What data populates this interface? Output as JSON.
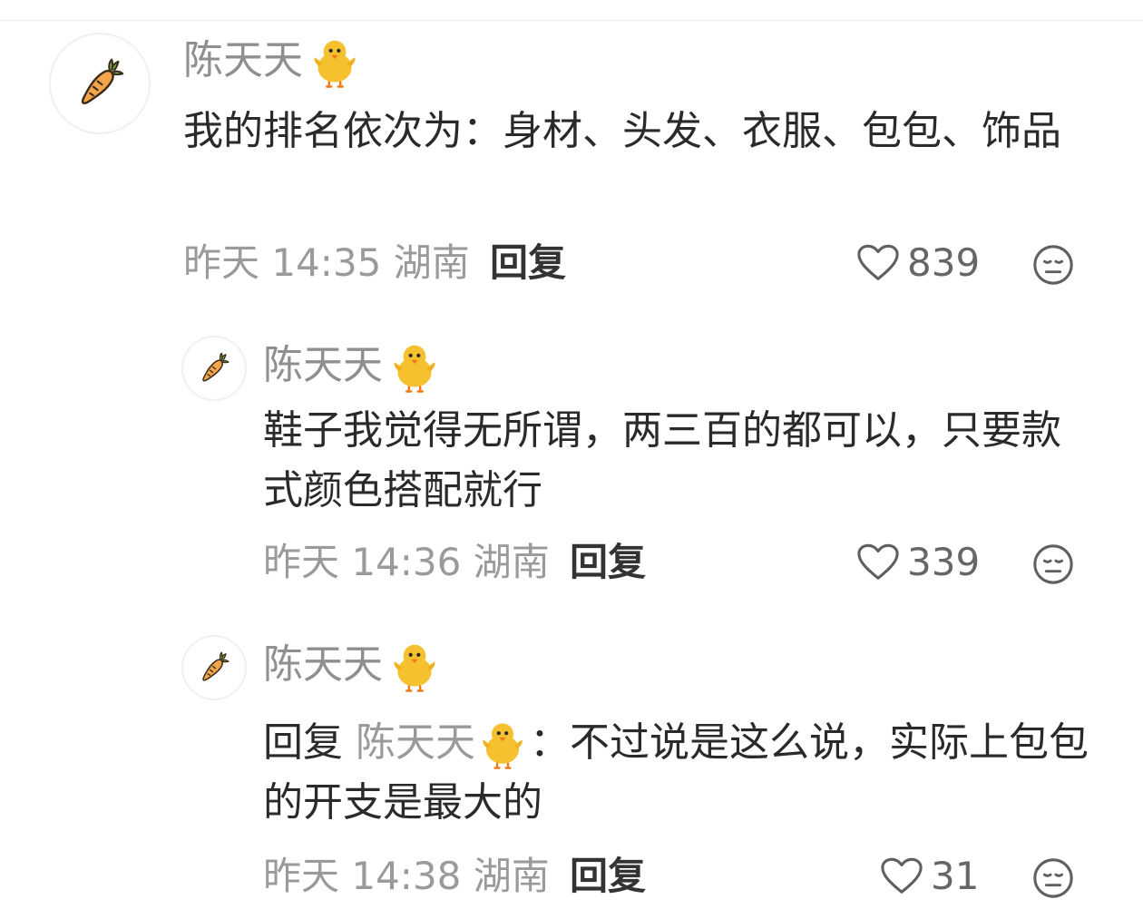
{
  "comments": [
    {
      "username": "陈天天",
      "text": "我的排名依次为：身材、头发、衣服、包包、饰品",
      "time": "昨天 14:35",
      "location": "湖南",
      "reply_label": "回复",
      "likes": "839",
      "avatar_icon": "carrot-icon",
      "username_icon": "chick-icon"
    },
    {
      "username": "陈天天",
      "text": "鞋子我觉得无所谓，两三百的都可以，只要款式颜色搭配就行",
      "time": "昨天 14:36",
      "location": "湖南",
      "reply_label": "回复",
      "likes": "339",
      "avatar_icon": "carrot-icon",
      "username_icon": "chick-icon"
    },
    {
      "username": "陈天天",
      "reply_prefix": "回复",
      "reply_to": "陈天天",
      "reply_sep": "：",
      "text": "不过说是这么说，实际上包包的开支是最大的",
      "time": "昨天 14:38",
      "location": "湖南",
      "reply_label": "回复",
      "likes": "31",
      "avatar_icon": "carrot-icon",
      "username_icon": "chick-icon"
    }
  ],
  "icons": {
    "like": "heart-outline-icon",
    "reaction": "neutral-face-icon"
  },
  "colors": {
    "username": "#8f8f8f",
    "text": "#2a2a2a",
    "meta": "#9a9a9a",
    "carrot": "#f0a040",
    "chick": "#f6c12e"
  }
}
